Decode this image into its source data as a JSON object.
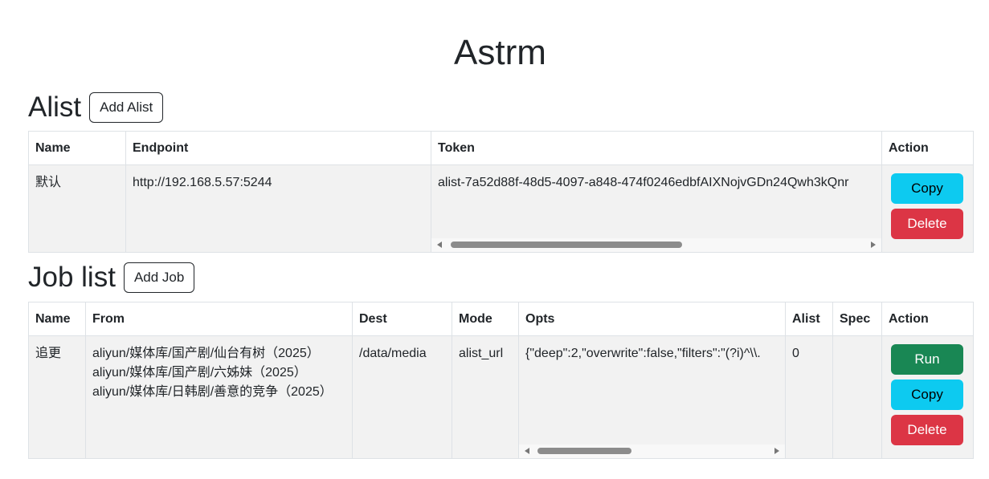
{
  "app": {
    "title": "Astrm"
  },
  "alist_section": {
    "heading": "Alist",
    "add_button": "Add Alist",
    "columns": [
      "Name",
      "Endpoint",
      "Token",
      "Action"
    ],
    "rows": [
      {
        "name": "默认",
        "endpoint": "http://192.168.5.57:5244",
        "token": "alist-7a52d88f-48d5-4097-a848-474f0246edbfAIXNojvGDn24Qwh3kQnr",
        "copy_label": "Copy",
        "delete_label": "Delete"
      }
    ]
  },
  "job_section": {
    "heading": "Job list",
    "add_button": "Add Job",
    "columns": [
      "Name",
      "From",
      "Dest",
      "Mode",
      "Opts",
      "Alist",
      "Spec",
      "Action"
    ],
    "rows": [
      {
        "name": "追更",
        "from": [
          "aliyun/媒体库/国产剧/仙台有树（2025）",
          "aliyun/媒体库/国产剧/六姊妹（2025）",
          "aliyun/媒体库/日韩剧/善意的竞争（2025）"
        ],
        "dest": "/data/media",
        "mode": "alist_url",
        "opts": "{\"deep\":2,\"overwrite\":false,\"filters\":\"(?i)^\\\\.",
        "alist": "0",
        "spec": "",
        "run_label": "Run",
        "copy_label": "Copy",
        "delete_label": "Delete"
      }
    ]
  },
  "colors": {
    "copy": "#0dcaf0",
    "delete": "#dc3545",
    "run": "#198754",
    "row_bg": "#f2f2f2"
  }
}
